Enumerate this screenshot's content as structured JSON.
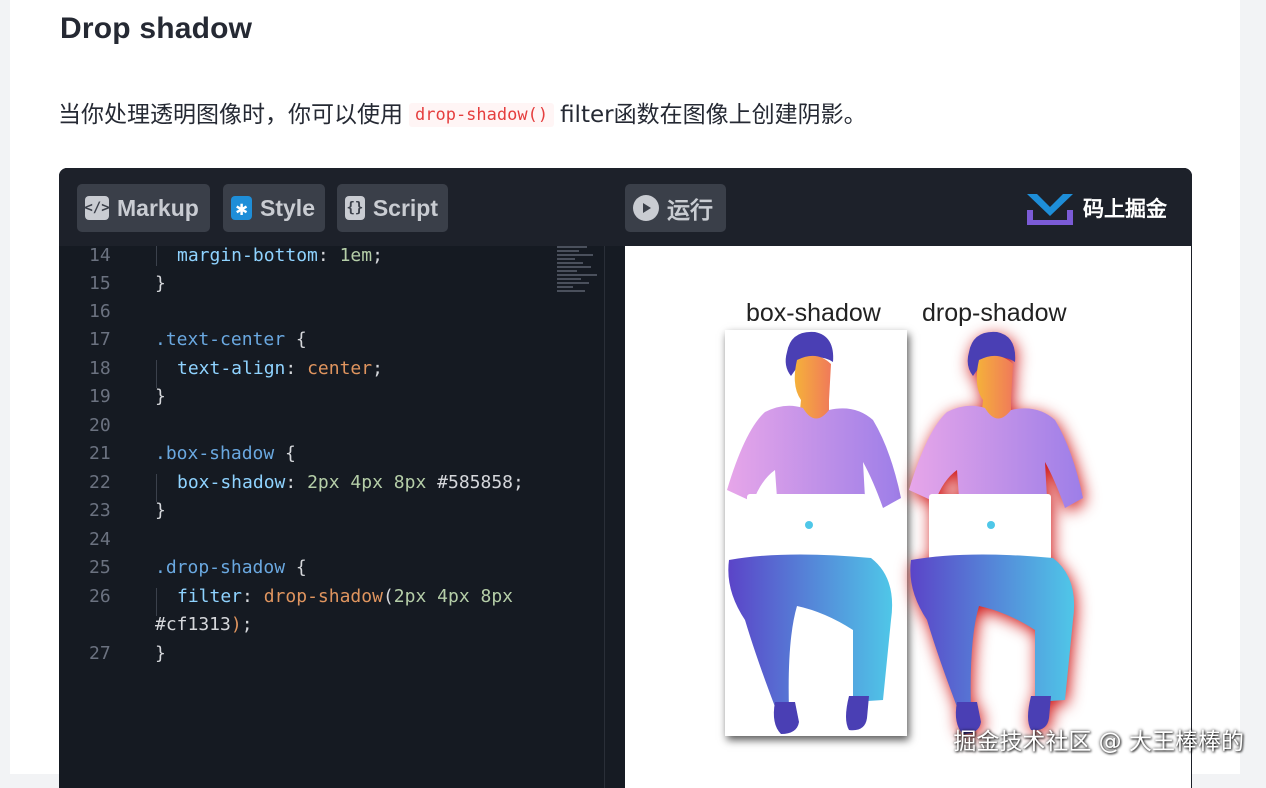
{
  "article": {
    "heading": "Drop shadow",
    "para_before": "当你处理透明图像时，你可以使用",
    "para_code": "drop-shadow()",
    "para_after": "filter函数在图像上创建阴影。"
  },
  "toolbar": {
    "markup_label": "Markup",
    "style_label": "Style",
    "script_label": "Script",
    "run_label": "运行",
    "logo_text": "码上掘金"
  },
  "editor": {
    "lines": [
      {
        "n": "14"
      },
      {
        "n": "15"
      },
      {
        "n": "16"
      },
      {
        "n": "17"
      },
      {
        "n": "18"
      },
      {
        "n": "19"
      },
      {
        "n": "20"
      },
      {
        "n": "21"
      },
      {
        "n": "22"
      },
      {
        "n": "23"
      },
      {
        "n": "24"
      },
      {
        "n": "25"
      },
      {
        "n": "26"
      },
      {
        "n": ""
      },
      {
        "n": "27"
      }
    ],
    "tokens": {
      "l14_prop": "margin-bottom",
      "l14_num": "1em",
      "brace_close": "}",
      "l17_sel": ".text-center",
      "l18_prop": "text-align",
      "l18_val": "center",
      "l21_sel": ".box-shadow",
      "l22_prop": "box-shadow",
      "l22_n1": "2px",
      "l22_n2": "4px",
      "l22_n3": "8px",
      "l22_color": "#585858",
      "l25_sel": ".drop-shadow",
      "l26_prop": "filter",
      "l26_fn": "drop-shadow",
      "l26_n1": "2px",
      "l26_n2": "4px",
      "l26_n3": "8px",
      "l26b_color": "#cf1313"
    }
  },
  "preview": {
    "caption_box": "box-shadow",
    "caption_drop": "drop-shadow",
    "box_shadow_color": "#585858",
    "drop_shadow_color": "#cf1313"
  },
  "watermark": "掘金技术社区 @ 大王棒棒的",
  "colors": {
    "accent_blue": "#1e8ed8",
    "code_inline": "#e53e3e",
    "editor_bg": "#151a22"
  }
}
